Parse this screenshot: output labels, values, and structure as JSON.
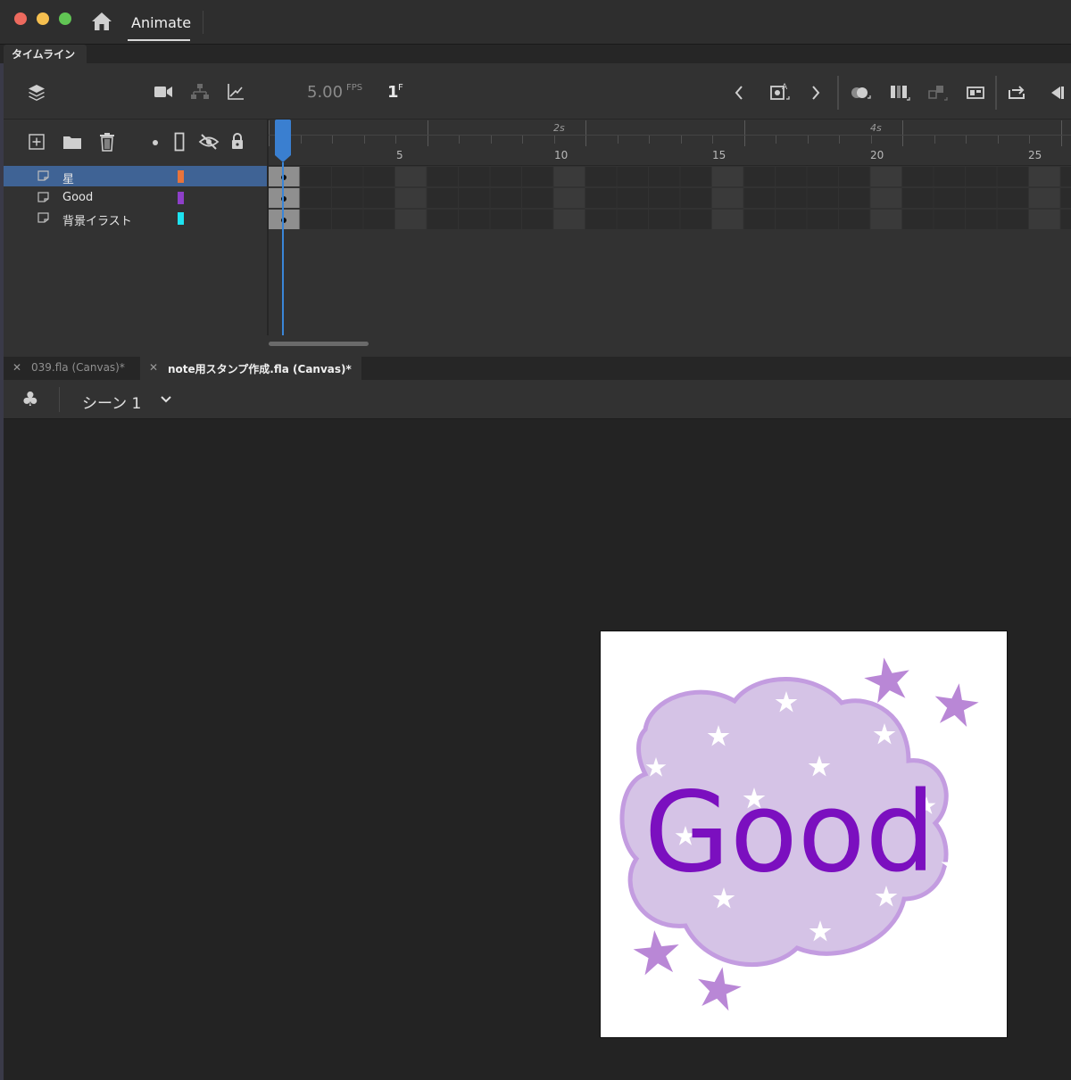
{
  "window": {
    "app_tab_label": "Animate"
  },
  "panel": {
    "tab_label": "タイムライン"
  },
  "timeline": {
    "fps_value": "5.00",
    "fps_unit": "FPS",
    "current_frame": "1",
    "frame_unit": "F",
    "ruler": {
      "frame_labels": [
        "5",
        "10",
        "15",
        "20",
        "25"
      ],
      "second_labels": [
        "2s",
        "4s"
      ]
    },
    "layers": [
      {
        "name": "星",
        "color": "#e8743b",
        "selected": true
      },
      {
        "name": "Good",
        "color": "#8e3fc9",
        "selected": false
      },
      {
        "name": "背景イラスト",
        "color": "#1de3f0",
        "selected": false
      }
    ]
  },
  "documents": {
    "tabs": [
      {
        "name": "039.fla (Canvas)*",
        "active": false
      },
      {
        "name": "note用スタンプ作成.fla (Canvas)*",
        "active": true
      }
    ]
  },
  "scene": {
    "name": "シーン 1"
  },
  "stage": {
    "artwork_text": "Good",
    "text_color": "#7b0fbf",
    "cloud_color": "#d5c3e6",
    "star_color": "#b987d6"
  }
}
